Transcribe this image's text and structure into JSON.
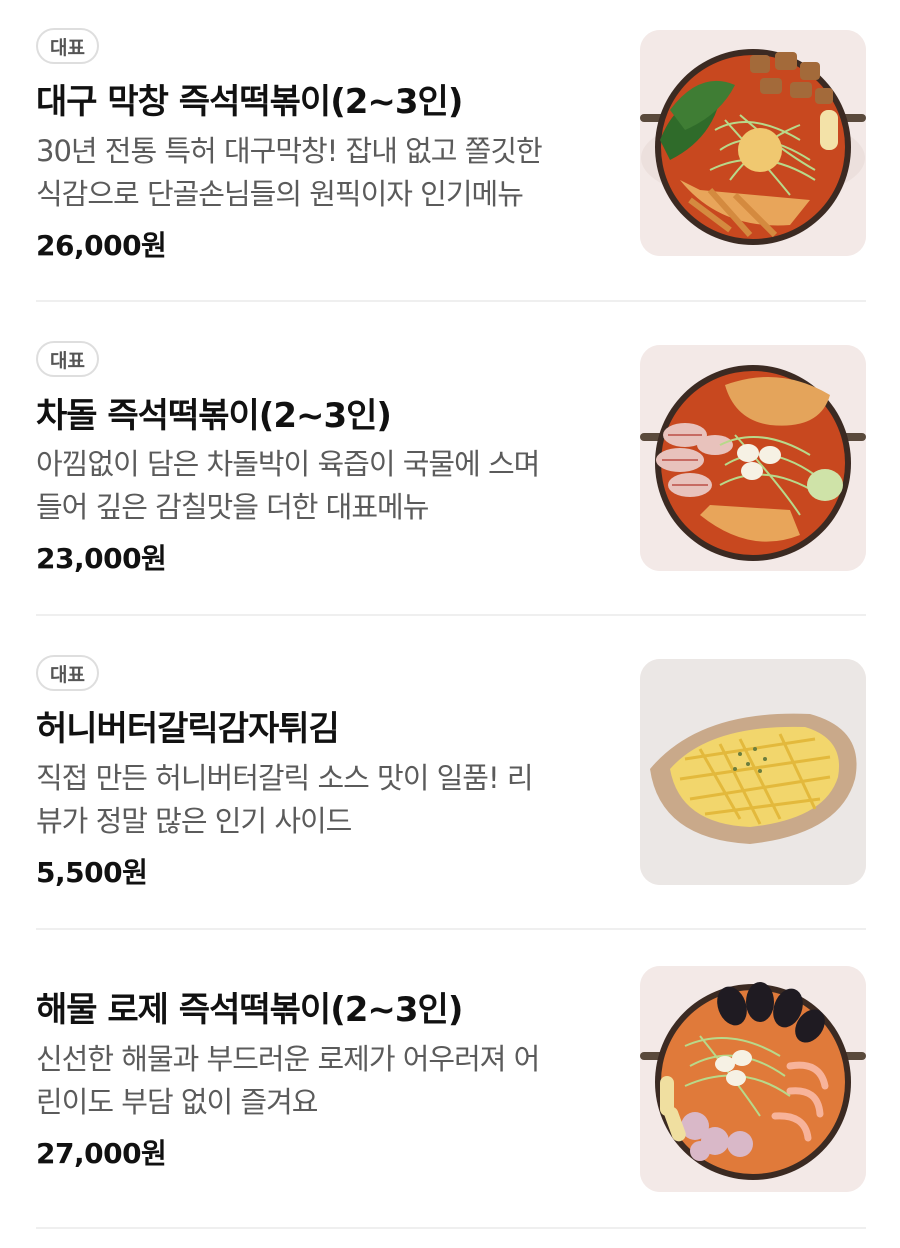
{
  "menu": {
    "items": [
      {
        "badge": "대표",
        "name": "대구 막창 즉석떡볶이(2~3인)",
        "desc_line1": "30년 전통 특허 대구막창! 잡내 없고 쫄깃한",
        "desc_line2": "식감으로 단골손님들의 원픽이자 인기메뉴",
        "price": "26,000원",
        "image": "dish-makchang-tteokbokki-photo"
      },
      {
        "badge": "대표",
        "name": "차돌 즉석떡볶이(2~3인)",
        "desc_line1": "아낌없이 담은 차돌박이 육즙이 국물에 스며",
        "desc_line2": "들어 깊은 감칠맛을 더한 대표메뉴",
        "price": "23,000원",
        "image": "dish-chadol-tteokbokki-photo"
      },
      {
        "badge": "대표",
        "name": "허니버터갈릭감자튀김",
        "desc_line1": "직접 만든 허니버터갈릭 소스 맛이 일품! 리",
        "desc_line2": "뷰가 정말 많은 인기 사이드",
        "price": "5,500원",
        "image": "dish-honey-butter-fries-photo"
      },
      {
        "badge": "",
        "name": "해물 로제 즉석떡볶이(2~3인)",
        "desc_line1": "신선한 해물과 부드러운 로제가 어우러져 어",
        "desc_line2": "린이도 부담 없이 즐겨요",
        "price": "27,000원",
        "image": "dish-seafood-rose-tteokbokki-photo"
      }
    ]
  }
}
